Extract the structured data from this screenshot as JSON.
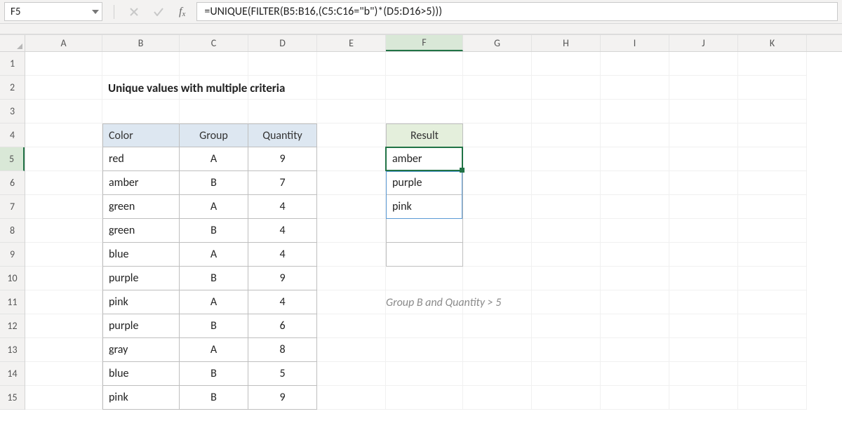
{
  "namebox": {
    "value": "F5"
  },
  "formula_bar": {
    "formula": "=UNIQUE(FILTER(B5:B16,(C5:C16=\"b\")*(D5:D16>5)))"
  },
  "columns": [
    "A",
    "B",
    "C",
    "D",
    "E",
    "F",
    "G",
    "H",
    "I",
    "J",
    "K"
  ],
  "row_numbers": [
    "1",
    "2",
    "3",
    "4",
    "5",
    "6",
    "7",
    "8",
    "9",
    "10",
    "11",
    "12",
    "13",
    "14",
    "15"
  ],
  "selected_cell": {
    "col": "F",
    "row": 5
  },
  "title": "Unique values with multiple criteria",
  "data_table": {
    "headers": {
      "color": "Color",
      "group": "Group",
      "qty": "Quantity"
    },
    "rows": [
      {
        "color": "red",
        "group": "A",
        "qty": "9"
      },
      {
        "color": "amber",
        "group": "B",
        "qty": "7"
      },
      {
        "color": "green",
        "group": "A",
        "qty": "4"
      },
      {
        "color": "green",
        "group": "B",
        "qty": "4"
      },
      {
        "color": "blue",
        "group": "A",
        "qty": "4"
      },
      {
        "color": "purple",
        "group": "B",
        "qty": "9"
      },
      {
        "color": "pink",
        "group": "A",
        "qty": "4"
      },
      {
        "color": "purple",
        "group": "B",
        "qty": "6"
      },
      {
        "color": "gray",
        "group": "A",
        "qty": "8"
      },
      {
        "color": "blue",
        "group": "B",
        "qty": "5"
      },
      {
        "color": "pink",
        "group": "B",
        "qty": "9"
      }
    ]
  },
  "result_table": {
    "header": "Result",
    "rows": [
      "amber",
      "purple",
      "pink",
      "",
      ""
    ]
  },
  "note": "Group B and Quantity > 5"
}
